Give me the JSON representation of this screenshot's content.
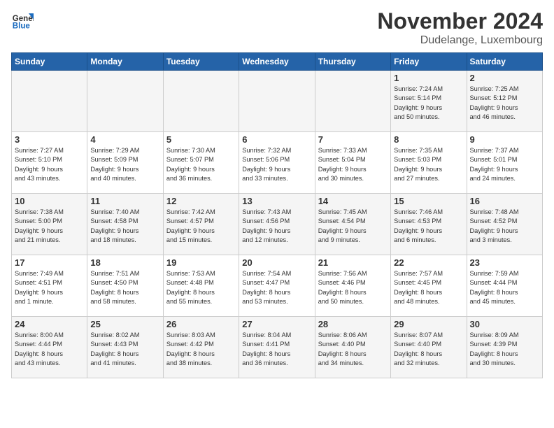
{
  "header": {
    "logo_general": "General",
    "logo_blue": "Blue",
    "month_title": "November 2024",
    "subtitle": "Dudelange, Luxembourg"
  },
  "days_of_week": [
    "Sunday",
    "Monday",
    "Tuesday",
    "Wednesday",
    "Thursday",
    "Friday",
    "Saturday"
  ],
  "weeks": [
    [
      {
        "day": "",
        "info": ""
      },
      {
        "day": "",
        "info": ""
      },
      {
        "day": "",
        "info": ""
      },
      {
        "day": "",
        "info": ""
      },
      {
        "day": "",
        "info": ""
      },
      {
        "day": "1",
        "info": "Sunrise: 7:24 AM\nSunset: 5:14 PM\nDaylight: 9 hours\nand 50 minutes."
      },
      {
        "day": "2",
        "info": "Sunrise: 7:25 AM\nSunset: 5:12 PM\nDaylight: 9 hours\nand 46 minutes."
      }
    ],
    [
      {
        "day": "3",
        "info": "Sunrise: 7:27 AM\nSunset: 5:10 PM\nDaylight: 9 hours\nand 43 minutes."
      },
      {
        "day": "4",
        "info": "Sunrise: 7:29 AM\nSunset: 5:09 PM\nDaylight: 9 hours\nand 40 minutes."
      },
      {
        "day": "5",
        "info": "Sunrise: 7:30 AM\nSunset: 5:07 PM\nDaylight: 9 hours\nand 36 minutes."
      },
      {
        "day": "6",
        "info": "Sunrise: 7:32 AM\nSunset: 5:06 PM\nDaylight: 9 hours\nand 33 minutes."
      },
      {
        "day": "7",
        "info": "Sunrise: 7:33 AM\nSunset: 5:04 PM\nDaylight: 9 hours\nand 30 minutes."
      },
      {
        "day": "8",
        "info": "Sunrise: 7:35 AM\nSunset: 5:03 PM\nDaylight: 9 hours\nand 27 minutes."
      },
      {
        "day": "9",
        "info": "Sunrise: 7:37 AM\nSunset: 5:01 PM\nDaylight: 9 hours\nand 24 minutes."
      }
    ],
    [
      {
        "day": "10",
        "info": "Sunrise: 7:38 AM\nSunset: 5:00 PM\nDaylight: 9 hours\nand 21 minutes."
      },
      {
        "day": "11",
        "info": "Sunrise: 7:40 AM\nSunset: 4:58 PM\nDaylight: 9 hours\nand 18 minutes."
      },
      {
        "day": "12",
        "info": "Sunrise: 7:42 AM\nSunset: 4:57 PM\nDaylight: 9 hours\nand 15 minutes."
      },
      {
        "day": "13",
        "info": "Sunrise: 7:43 AM\nSunset: 4:56 PM\nDaylight: 9 hours\nand 12 minutes."
      },
      {
        "day": "14",
        "info": "Sunrise: 7:45 AM\nSunset: 4:54 PM\nDaylight: 9 hours\nand 9 minutes."
      },
      {
        "day": "15",
        "info": "Sunrise: 7:46 AM\nSunset: 4:53 PM\nDaylight: 9 hours\nand 6 minutes."
      },
      {
        "day": "16",
        "info": "Sunrise: 7:48 AM\nSunset: 4:52 PM\nDaylight: 9 hours\nand 3 minutes."
      }
    ],
    [
      {
        "day": "17",
        "info": "Sunrise: 7:49 AM\nSunset: 4:51 PM\nDaylight: 9 hours\nand 1 minute."
      },
      {
        "day": "18",
        "info": "Sunrise: 7:51 AM\nSunset: 4:50 PM\nDaylight: 8 hours\nand 58 minutes."
      },
      {
        "day": "19",
        "info": "Sunrise: 7:53 AM\nSunset: 4:48 PM\nDaylight: 8 hours\nand 55 minutes."
      },
      {
        "day": "20",
        "info": "Sunrise: 7:54 AM\nSunset: 4:47 PM\nDaylight: 8 hours\nand 53 minutes."
      },
      {
        "day": "21",
        "info": "Sunrise: 7:56 AM\nSunset: 4:46 PM\nDaylight: 8 hours\nand 50 minutes."
      },
      {
        "day": "22",
        "info": "Sunrise: 7:57 AM\nSunset: 4:45 PM\nDaylight: 8 hours\nand 48 minutes."
      },
      {
        "day": "23",
        "info": "Sunrise: 7:59 AM\nSunset: 4:44 PM\nDaylight: 8 hours\nand 45 minutes."
      }
    ],
    [
      {
        "day": "24",
        "info": "Sunrise: 8:00 AM\nSunset: 4:44 PM\nDaylight: 8 hours\nand 43 minutes."
      },
      {
        "day": "25",
        "info": "Sunrise: 8:02 AM\nSunset: 4:43 PM\nDaylight: 8 hours\nand 41 minutes."
      },
      {
        "day": "26",
        "info": "Sunrise: 8:03 AM\nSunset: 4:42 PM\nDaylight: 8 hours\nand 38 minutes."
      },
      {
        "day": "27",
        "info": "Sunrise: 8:04 AM\nSunset: 4:41 PM\nDaylight: 8 hours\nand 36 minutes."
      },
      {
        "day": "28",
        "info": "Sunrise: 8:06 AM\nSunset: 4:40 PM\nDaylight: 8 hours\nand 34 minutes."
      },
      {
        "day": "29",
        "info": "Sunrise: 8:07 AM\nSunset: 4:40 PM\nDaylight: 8 hours\nand 32 minutes."
      },
      {
        "day": "30",
        "info": "Sunrise: 8:09 AM\nSunset: 4:39 PM\nDaylight: 8 hours\nand 30 minutes."
      }
    ]
  ]
}
